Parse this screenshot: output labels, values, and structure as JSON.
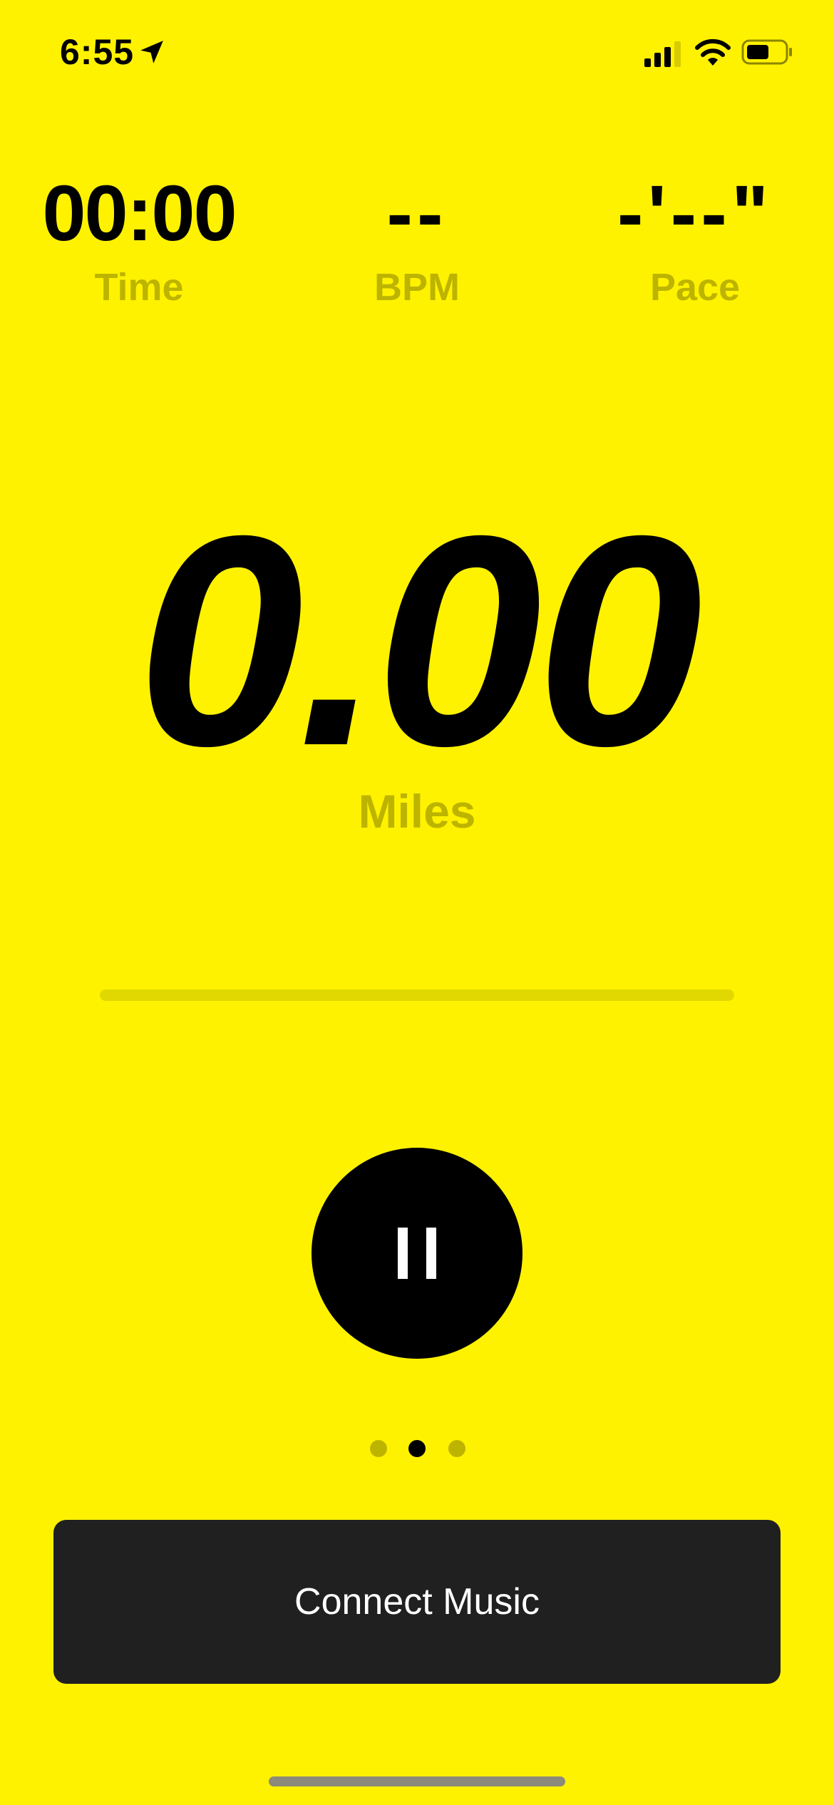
{
  "status_bar": {
    "time": "6:55",
    "icons": [
      "location-arrow-icon",
      "cellular-signal-icon",
      "wifi-icon",
      "battery-icon"
    ]
  },
  "stats": {
    "time": {
      "value": "00:00",
      "label": "Time"
    },
    "bpm": {
      "value": "--",
      "label": "BPM"
    },
    "pace": {
      "value": "-'--\"",
      "label": "Pace"
    }
  },
  "distance": {
    "value": "0.00",
    "unit": "Miles"
  },
  "progress": {
    "fraction": 0
  },
  "controls": {
    "pause_icon": "pause-icon"
  },
  "pager": {
    "total": 3,
    "active_index": 1
  },
  "connect_music": {
    "label": "Connect Music"
  },
  "colors": {
    "background": "#FFF200",
    "muted_label": "#BDB400",
    "button_dark": "#202020",
    "primary": "#000000"
  }
}
